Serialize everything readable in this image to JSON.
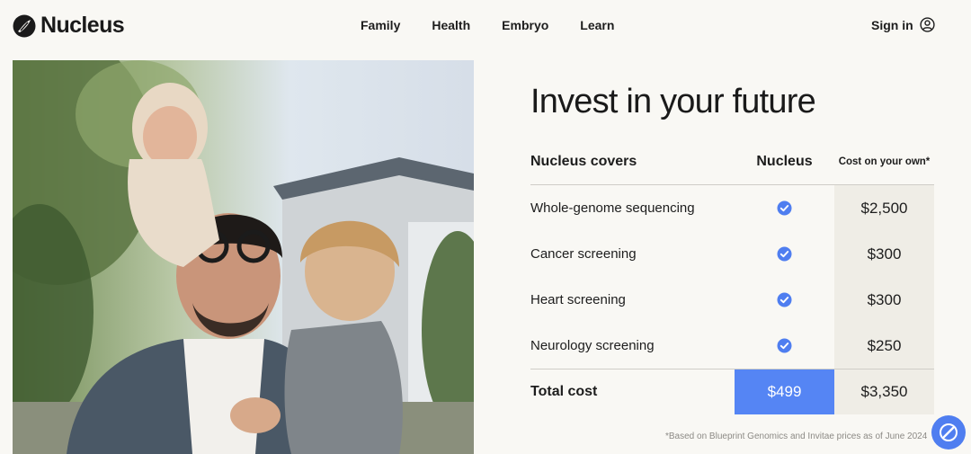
{
  "brand": {
    "name": "Nucleus"
  },
  "nav": {
    "items": [
      "Family",
      "Health",
      "Embryo",
      "Learn"
    ]
  },
  "header": {
    "signin_label": "Sign in"
  },
  "hero": {
    "title": "Invest in your future"
  },
  "pricing": {
    "headers": {
      "item": "Nucleus covers",
      "nucleus": "Nucleus",
      "own": "Cost on your own*"
    },
    "rows": [
      {
        "label": "Whole-genome sequencing",
        "included": true,
        "own_cost": "$2,500"
      },
      {
        "label": "Cancer screening",
        "included": true,
        "own_cost": "$300"
      },
      {
        "label": "Heart screening",
        "included": true,
        "own_cost": "$300"
      },
      {
        "label": "Neurology screening",
        "included": true,
        "own_cost": "$250"
      }
    ],
    "total": {
      "label": "Total cost",
      "nucleus": "$499",
      "own": "$3,350"
    },
    "footnote": "*Based on Blueprint Genomics and Invitae prices as of June 2024"
  },
  "colors": {
    "accent": "#5585f4",
    "background": "#f9f8f4",
    "shade": "#efede6"
  },
  "icons": {
    "check": "check-circle-icon",
    "user": "user-circle-icon",
    "chat": "chat-launcher-icon"
  }
}
